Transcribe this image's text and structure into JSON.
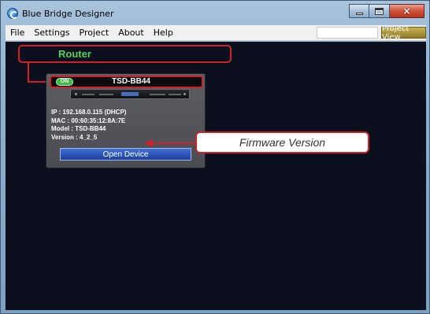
{
  "window": {
    "title": "Blue Bridge Designer",
    "controls": {
      "minimize": "minimize",
      "maximize": "maximize",
      "close": "×"
    }
  },
  "menu": {
    "items": [
      "File",
      "Settings",
      "Project",
      "About",
      "Help"
    ],
    "project_view": "Project View"
  },
  "canvas": {
    "router_label": "Router",
    "device": {
      "status": "ON",
      "name": "TSD-BB44",
      "ip": "IP : 192.168.0.115 (DHCP)",
      "mac": "MAC : 00:60:35:12:8A:7E",
      "model": "Model : TSD-BB44",
      "version": "Version : 4_2_5",
      "open_button": "Open Device"
    },
    "callout": "Firmware Version"
  },
  "colors": {
    "annotation_red": "#d0202a",
    "router_green": "#58d35c",
    "status_green": "#3fb848",
    "canvas_bg": "#0c0f1e",
    "button_blue": "#2a52b8"
  }
}
